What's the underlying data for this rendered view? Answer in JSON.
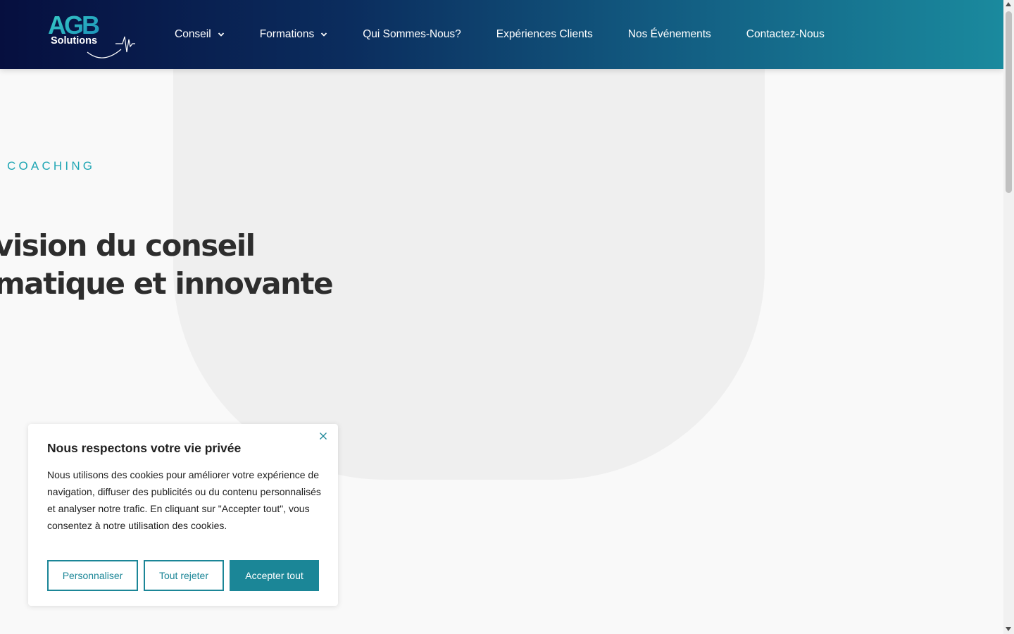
{
  "header": {
    "logo_text": "AGB Solutions",
    "nav": [
      {
        "label": "Conseil",
        "has_dropdown": true
      },
      {
        "label": "Formations",
        "has_dropdown": true
      },
      {
        "label": "Qui Sommes-Nous?",
        "has_dropdown": false
      },
      {
        "label": "Expériences Clients",
        "has_dropdown": false
      },
      {
        "label": "Nos Événements",
        "has_dropdown": false
      },
      {
        "label": "Contactez-Nous",
        "has_dropdown": false
      }
    ]
  },
  "hero": {
    "eyebrow": "COACHING",
    "headline_line1": "vision du conseil",
    "headline_line2": "matique et innovante"
  },
  "cookie_banner": {
    "title": "Nous respectons votre vie privée",
    "text": "Nous utilisons des cookies pour améliorer votre expérience de navigation, diffuser des publicités ou du contenu personnalisés et analyser notre trafic. En cliquant sur \"Accepter tout\", vous consentez à notre utilisation des cookies.",
    "buttons": {
      "customize": "Personnaliser",
      "reject": "Tout rejeter",
      "accept": "Accepter tout"
    }
  },
  "colors": {
    "accent": "#1b8697",
    "eyebrow": "#1fa6b4",
    "header_start": "#060f3f",
    "header_end": "#1a8a9e"
  }
}
